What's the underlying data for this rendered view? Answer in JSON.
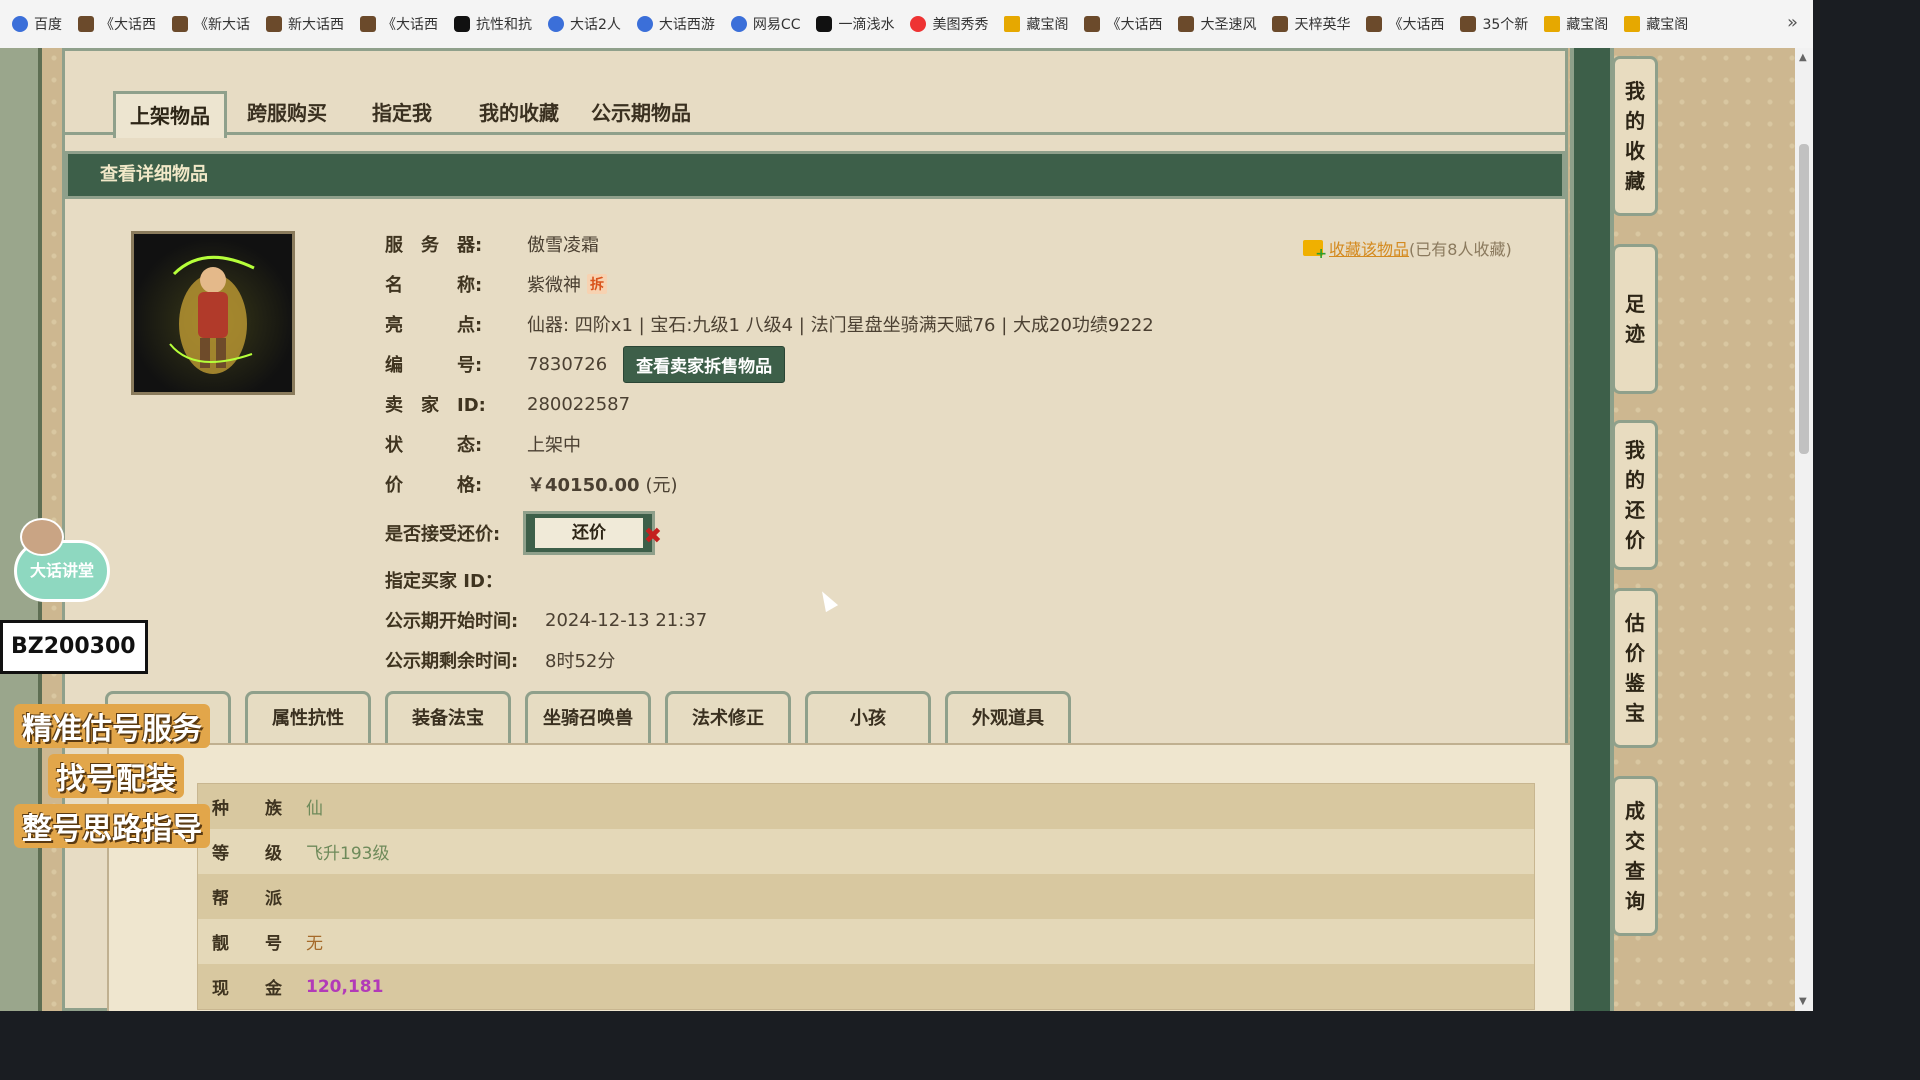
{
  "bookmarks": [
    {
      "label": "百度",
      "icon": "baidu-icon",
      "cls": "blue"
    },
    {
      "label": "《大话西",
      "icon": "game-icon",
      "cls": ""
    },
    {
      "label": "《新大话",
      "icon": "game-icon",
      "cls": ""
    },
    {
      "label": "新大话西",
      "icon": "game-icon",
      "cls": ""
    },
    {
      "label": "《大话西",
      "icon": "game-icon",
      "cls": ""
    },
    {
      "label": "抗性和抗",
      "icon": "doc-icon",
      "cls": "black"
    },
    {
      "label": "大话2人",
      "icon": "netease-icon",
      "cls": "blue"
    },
    {
      "label": "大话西游",
      "icon": "netease-icon",
      "cls": "blue"
    },
    {
      "label": "网易CC",
      "icon": "cc-icon",
      "cls": "blue"
    },
    {
      "label": "一滴浅水",
      "icon": "douyin-icon",
      "cls": "black"
    },
    {
      "label": "美图秀秀",
      "icon": "meitu-icon",
      "cls": "red"
    },
    {
      "label": "藏宝阁",
      "icon": "treasure-icon",
      "cls": "yellow"
    },
    {
      "label": "《大话西",
      "icon": "game-icon",
      "cls": ""
    },
    {
      "label": "大圣速风",
      "icon": "game-icon",
      "cls": ""
    },
    {
      "label": "天梓英华",
      "icon": "game-icon",
      "cls": ""
    },
    {
      "label": "《大话西",
      "icon": "game-icon",
      "cls": ""
    },
    {
      "label": "35个新",
      "icon": "game-icon",
      "cls": ""
    },
    {
      "label": "藏宝阁",
      "icon": "treasure-icon",
      "cls": "yellow"
    },
    {
      "label": "藏宝阁",
      "icon": "treasure-icon",
      "cls": "yellow"
    }
  ],
  "bookmarks_more": "»",
  "tabs": [
    "上架物品",
    "跨服购买",
    "指定我",
    "我的收藏",
    "公示期物品"
  ],
  "detail_header": "查看详细物品",
  "fields": {
    "server_label": "服　务　器:",
    "server_value": "傲雪凌霜",
    "name_label": "名　　　称:",
    "name_value": "紫微神",
    "name_tag": "拆",
    "highlight_label": "亮　　　点:",
    "highlight_value": "仙器: 四阶x1 | 宝石:九级1 八级4 | 法门星盘坐骑满天赋76 | 大成20功绩9222",
    "number_label": "编　　　号:",
    "number_value": "7830726",
    "seller_items_button": "查看卖家拆售物品",
    "seller_label": "卖　家　ID:",
    "seller_value": "280022587",
    "status_label": "状　　　态:",
    "status_value": "上架中",
    "price_label": "价　　　格:",
    "price_value": "￥40150.00",
    "price_unit": "(元)",
    "counter_label": "是否接受还价:",
    "counter_button": "还价",
    "buyer_label": "指定买家 ID：",
    "buyer_value": "",
    "public_start_label": "公示期开始时间:",
    "public_start_value": "2024-12-13 21:37",
    "public_remain_label": "公示期剩余时间:",
    "public_remain_value": "8时52分"
  },
  "favorite": {
    "link": "收藏该物品",
    "count": "(已有8人收藏)"
  },
  "subtabs": [
    "信息",
    "属性抗性",
    "装备法宝",
    "坐骑召唤兽",
    "法术修正",
    "小孩",
    "外观道具"
  ],
  "info_rows": [
    {
      "k1": "种",
      "k2": "族",
      "v": "仙",
      "cls": ""
    },
    {
      "k1": "等",
      "k2": "级",
      "v": "飞升193级",
      "cls": ""
    },
    {
      "k1": "帮",
      "k2": "派",
      "v": "",
      "cls": ""
    },
    {
      "k1": "靓",
      "k2": "号",
      "v": "无",
      "cls": "brown"
    },
    {
      "k1": "现",
      "k2": "金",
      "v": "120,181",
      "cls": "purple"
    }
  ],
  "side_nav": [
    {
      "text": [
        "我",
        "的",
        "收",
        "藏"
      ]
    },
    {
      "text": [
        "足",
        "迹"
      ]
    },
    {
      "text": [
        "我",
        "的",
        "还",
        "价"
      ]
    },
    {
      "text": [
        "估",
        "价",
        "鉴",
        "宝"
      ]
    },
    {
      "text": [
        "成",
        "交",
        "查",
        "询"
      ]
    }
  ],
  "promo": {
    "badge": "大话讲堂",
    "code": "BZ200300",
    "lines": [
      "精准估号服务",
      "找号配装",
      "整号思路指导"
    ]
  }
}
